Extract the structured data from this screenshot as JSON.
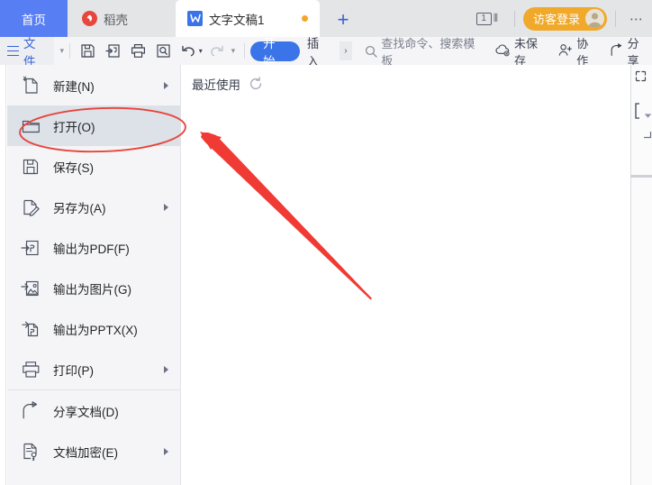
{
  "titlebar": {
    "tabs": [
      {
        "id": "home",
        "label": "首页",
        "icon": "home-tab"
      },
      {
        "id": "docer",
        "label": "稻壳",
        "icon": "docer-logo-icon"
      },
      {
        "id": "doc1",
        "label": "文字文稿1",
        "icon": "wps-writer-icon",
        "modified": true
      }
    ],
    "new_tab_label": "+",
    "window_count": "1",
    "login_label": "访客登录",
    "more_label": "⋯"
  },
  "toolbar": {
    "file_label": "文件",
    "quick_access": [
      {
        "name": "save-icon",
        "title": "保存"
      },
      {
        "name": "save-as-icon",
        "title": "另存为"
      },
      {
        "name": "print-icon",
        "title": "打印"
      },
      {
        "name": "print-preview-icon",
        "title": "打印预览"
      },
      {
        "name": "undo-icon",
        "title": "撤销"
      },
      {
        "name": "redo-icon",
        "title": "恢复"
      }
    ],
    "ribbon_tabs": [
      {
        "label": "开始",
        "active": true
      },
      {
        "label": "插入",
        "active": false
      }
    ],
    "ribbon_next": "›",
    "search_placeholder": "查找命令、搜索模板",
    "right_items": [
      {
        "label": "未保存",
        "icon": "cloud-unsaved-icon"
      },
      {
        "label": "协作",
        "icon": "collaborate-icon"
      },
      {
        "label": "分享",
        "icon": "share-icon"
      }
    ]
  },
  "file_menu": {
    "items": [
      {
        "label": "新建(N)",
        "icon": "new-document-icon",
        "submenu": true,
        "selected": false
      },
      {
        "label": "打开(O)",
        "icon": "open-folder-icon",
        "submenu": false,
        "selected": true
      },
      {
        "label": "保存(S)",
        "icon": "save-disk-icon",
        "submenu": false,
        "selected": false
      },
      {
        "label": "另存为(A)",
        "icon": "save-as-pencil-icon",
        "submenu": true,
        "selected": false
      },
      {
        "label": "输出为PDF(F)",
        "icon": "export-pdf-icon",
        "submenu": false,
        "selected": false
      },
      {
        "label": "输出为图片(G)",
        "icon": "export-image-icon",
        "submenu": false,
        "selected": false
      },
      {
        "label": "输出为PPTX(X)",
        "icon": "export-pptx-icon",
        "submenu": false,
        "selected": false
      },
      {
        "label": "打印(P)",
        "icon": "printer-icon",
        "submenu": true,
        "selected": false
      },
      {
        "label": "分享文档(D)",
        "icon": "share-document-icon",
        "submenu": false,
        "selected": false
      },
      {
        "label": "文档加密(E)",
        "icon": "document-lock-icon",
        "submenu": true,
        "selected": false
      }
    ]
  },
  "content": {
    "recent_label": "最近使用",
    "refresh_icon": "refresh-icon"
  },
  "annotations": {
    "ellipse_color": "#e8453c",
    "arrow_color": "#f03b35",
    "ellipse_target": "打开(O)"
  },
  "colors": {
    "accent_blue": "#3a74e8",
    "home_tab_blue": "#587ef4",
    "titlebar_gray": "#e4e5e7",
    "toolbar_gray": "#f5f5f7",
    "menu_panel_gray": "#f5f5f7",
    "menu_selected_gray": "#dde1e8",
    "login_orange": "#f0a92a",
    "docer_red": "#e8453c"
  }
}
